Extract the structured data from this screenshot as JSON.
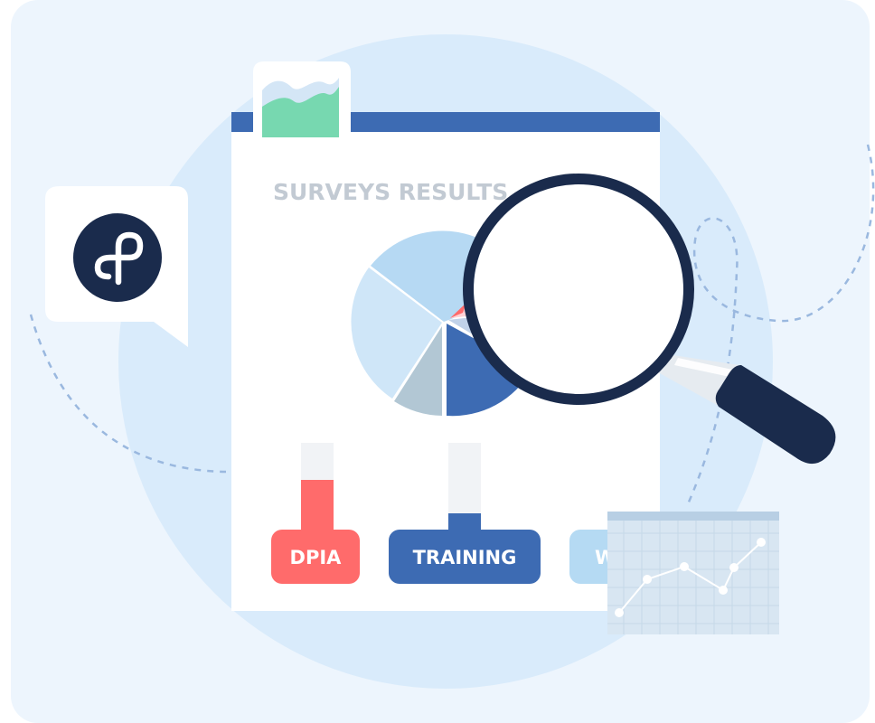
{
  "colors": {
    "background": "#edf5fd",
    "circle": "#d9ebfb",
    "document_bar": "#3d6bb3",
    "navy": "#1a2b4c",
    "dpia": "#ff6b6b",
    "training": "#3d6bb3",
    "third_tag": "#b5daf3",
    "pie_light_blue": "#b6d9f3",
    "pie_pale_blue": "#cfe6f8",
    "pie_gray": "#b2c7d4",
    "pie_blue": "#3d6bb3",
    "pie_lavender": "#c1d2e9",
    "pie_pink": "#ffd3d6",
    "chart_green": "#77d8b0"
  },
  "report": {
    "title": "SURVEYS RESULTS",
    "tags": [
      {
        "label": "DPIA"
      },
      {
        "label": "TRAINING"
      },
      {
        "label": "W"
      }
    ]
  },
  "logo": {
    "icon": "logo-icon"
  },
  "icons": [
    "magnifier-icon",
    "area-chart-icon",
    "line-chart-icon",
    "logo-icon"
  ]
}
